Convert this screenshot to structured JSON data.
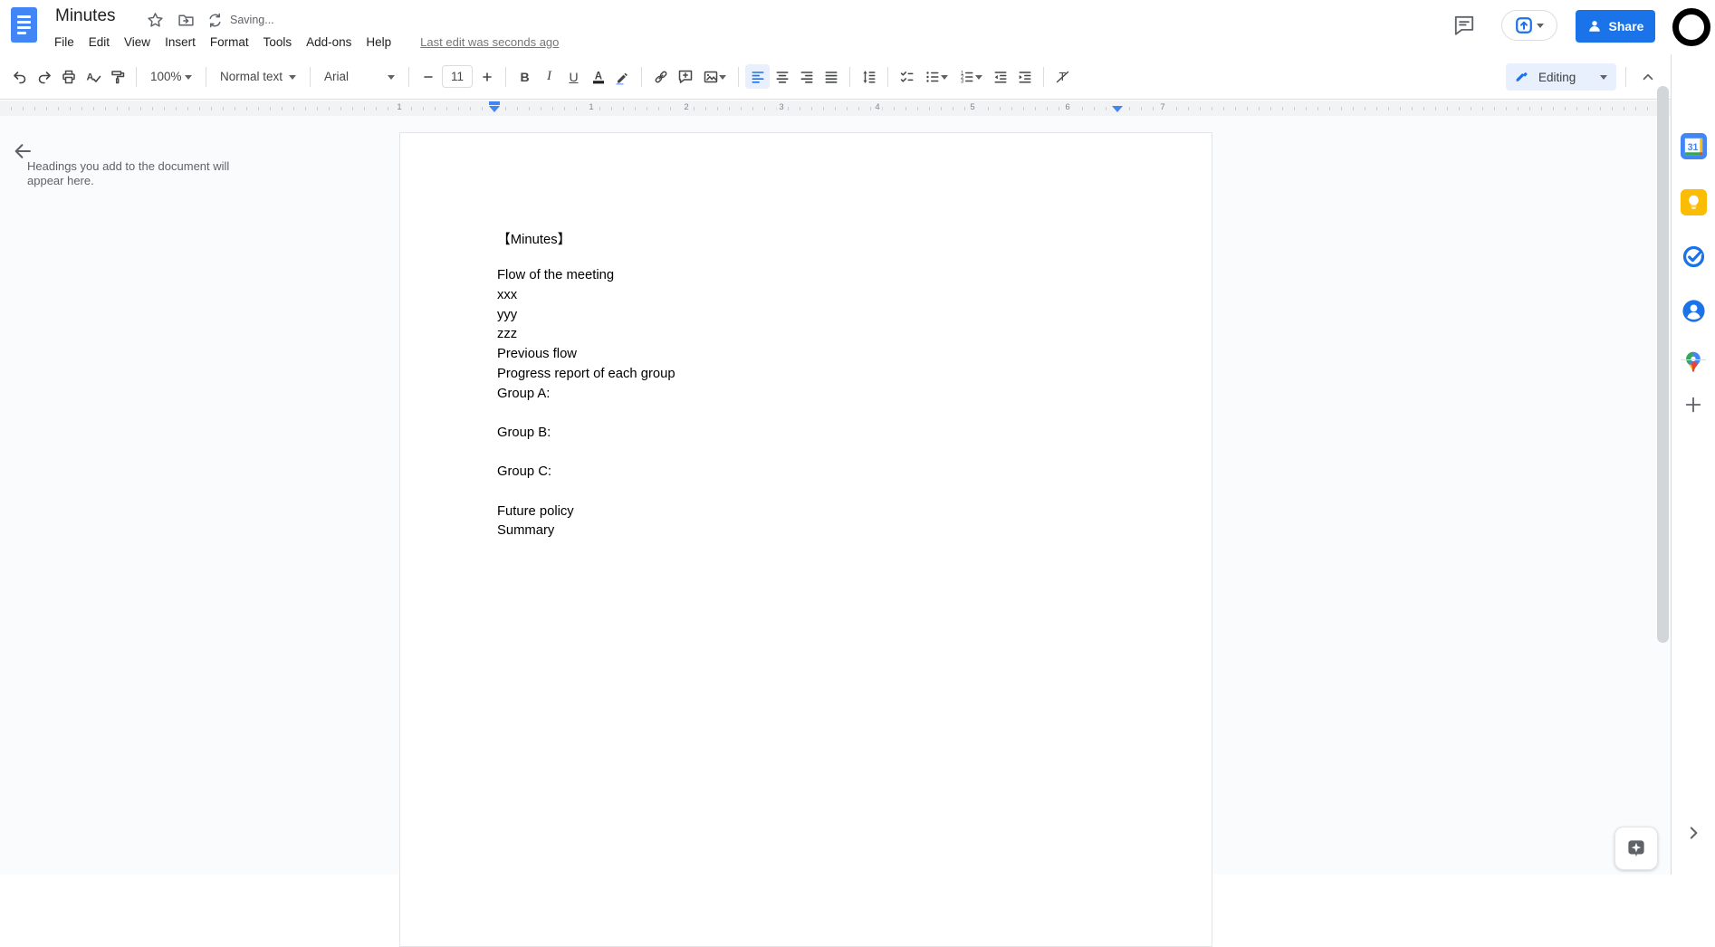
{
  "titlebar": {
    "doc_title": "Minutes",
    "saving_status": "Saving...",
    "last_edit": "Last edit was seconds ago",
    "menus": [
      "File",
      "Edit",
      "View",
      "Insert",
      "Format",
      "Tools",
      "Add-ons",
      "Help"
    ],
    "share_label": "Share",
    "icon_names": [
      "docs-logo",
      "star-icon",
      "move-folder-icon",
      "sync-icon",
      "comments-icon",
      "present-icon",
      "share-person-icon",
      "avatar"
    ]
  },
  "toolbar": {
    "zoom_value": "100%",
    "style_value": "Normal text",
    "font_value": "Arial",
    "font_size_value": "11",
    "mode_label": "Editing",
    "glyphs": {
      "bold": "B",
      "italic": "I",
      "underline": "U",
      "spell": "A",
      "text_color": "A",
      "clear_format": "T",
      "num1": "1",
      "num2": "2",
      "num3": "3"
    },
    "icon_names": [
      "undo",
      "redo",
      "print",
      "spelling-check",
      "paint-format",
      "insert-link",
      "add-comment",
      "insert-image",
      "align-left",
      "align-center",
      "align-right",
      "justify",
      "line-spacing",
      "checklist",
      "bulleted-list",
      "numbered-list",
      "decrease-indent",
      "increase-indent",
      "clear-formatting",
      "mode-pencil",
      "collapse-toolbar"
    ]
  },
  "ruler": {
    "numbers": [
      "1",
      "1",
      "2",
      "3",
      "4",
      "5",
      "6",
      "7"
    ]
  },
  "outline_panel": {
    "placeholder": "Headings you add to the document will appear here."
  },
  "document": {
    "lines": [
      "【Minutes】",
      "",
      "Flow of the meeting",
      "xxx",
      "yyy",
      "zzz",
      "Previous flow",
      "Progress report of each group",
      "Group A:",
      "",
      "Group B:",
      "",
      "Group C:",
      "",
      "Future policy",
      "Summary"
    ]
  },
  "side_panel": {
    "calendar_day": "31",
    "icon_names": [
      "google-calendar",
      "google-keep",
      "google-tasks",
      "google-contacts",
      "google-maps",
      "get-add-ons",
      "show-side-panel",
      "explore"
    ]
  }
}
